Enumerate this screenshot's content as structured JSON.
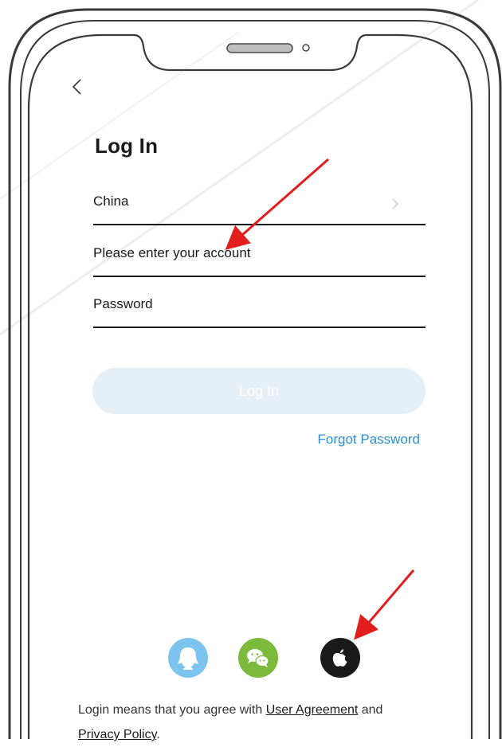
{
  "colors": {
    "accent_link": "#2b8fd6",
    "login_button_bg": "#e6eef6",
    "qq": "#7cc3ee",
    "wechat": "#7cba3b",
    "apple": "#1a1a1a",
    "annotation_arrow": "#e11d1d"
  },
  "nav": {
    "back_icon": "chevron-left-icon"
  },
  "page": {
    "title": "Log In"
  },
  "form": {
    "region": {
      "value": "China",
      "icon": "chevron-right-icon"
    },
    "account": {
      "placeholder": "Please  enter your account"
    },
    "password": {
      "placeholder": "Password"
    },
    "login_label": "Log In",
    "forgot_label": "Forgot Password"
  },
  "social": [
    {
      "name": "QQ",
      "icon": "qq-penguin-icon"
    },
    {
      "name": "WeChat",
      "icon": "wechat-icon"
    },
    {
      "name": "Apple",
      "icon": "apple-icon"
    }
  ],
  "agreement": {
    "prefix": "Login means that you agree with ",
    "user_agreement": "User Agreement",
    "and": " and",
    "privacy_policy": "Privacy Policy",
    "suffix": "."
  }
}
